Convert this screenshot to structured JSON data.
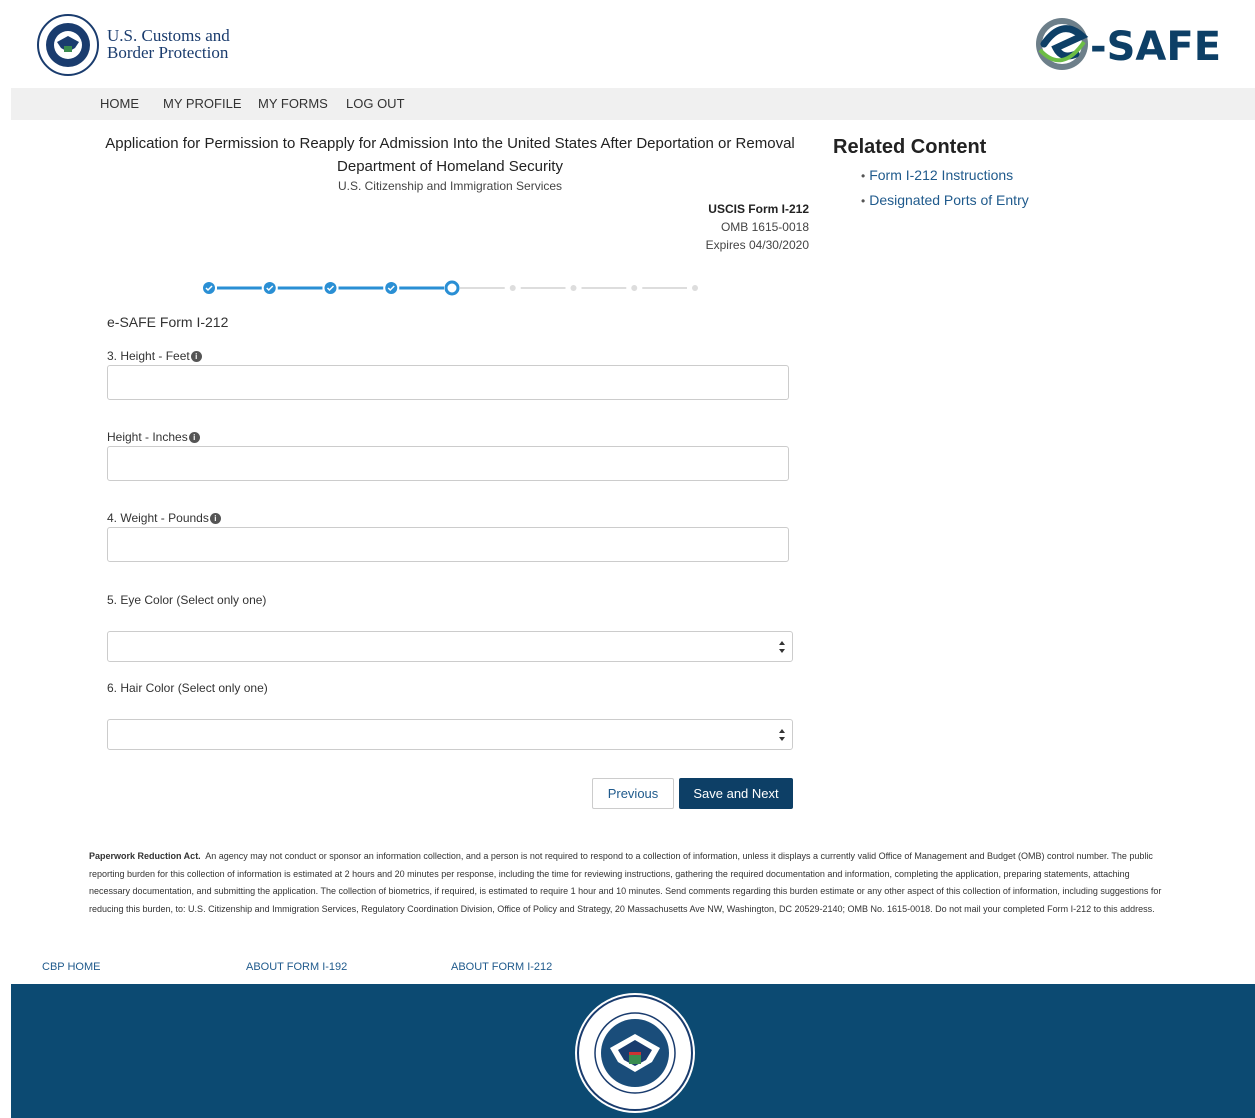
{
  "header": {
    "agency_line1": "U.S. Customs and",
    "agency_line2": "Border Protection",
    "logo_text": "-SAFE"
  },
  "nav": {
    "items": [
      {
        "label": "HOME"
      },
      {
        "label": "MY PROFILE"
      },
      {
        "label": "MY FORMS"
      },
      {
        "label": "LOG OUT"
      }
    ]
  },
  "page": {
    "title": "Application for Permission to Reapply for Admission Into the United States After Deportation or Removal",
    "department": "Department of Homeland Security",
    "agency": "U.S. Citizenship and Immigration Services",
    "form_id": "USCIS Form I-212",
    "omb": "OMB 1615-0018",
    "expires": "Expires 04/30/2020"
  },
  "related": {
    "title": "Related Content",
    "links": [
      {
        "label": "Form I-212 Instructions"
      },
      {
        "label": "Designated Ports of Entry"
      }
    ]
  },
  "progress": {
    "total_steps": 9,
    "current_step": 5,
    "completed_steps": 4
  },
  "form": {
    "heading": "e-SAFE Form I-212",
    "fields": [
      {
        "label": "3. Height - Feet",
        "value": "",
        "type": "text"
      },
      {
        "label": "Height - Inches",
        "value": "",
        "type": "text"
      },
      {
        "label": "4. Weight - Pounds",
        "value": "",
        "type": "text"
      },
      {
        "label": "5. Eye Color (Select only one)",
        "value": "",
        "type": "select"
      },
      {
        "label": "6. Hair Color (Select only one)",
        "value": "",
        "type": "select"
      }
    ],
    "previous_label": "Previous",
    "next_label": "Save and Next"
  },
  "paperwork": {
    "heading": "Paperwork Reduction Act.",
    "body": "An agency may not conduct or sponsor an information collection, and a person is not required to respond to a collection of information, unless it displays a currently valid Office of Management and Budget (OMB) control number.  The public reporting burden for this collection of information is estimated at 2 hours and 20 minutes per response, including the time for reviewing instructions, gathering the required documentation and information, completing the application, preparing statements, attaching necessary documentation, and submitting the application.  The collection of biometrics, if required, is estimated to require 1 hour and 10 minutes.  Send comments regarding this burden estimate or any other aspect of this collection of information, including suggestions for reducing this burden, to:  U.S. Citizenship and Immigration Services, Regulatory Coordination Division, Office of Policy and Strategy, 20 Massachusetts Ave NW, Washington, DC 20529-2140; OMB No. 1615-0018.  Do not mail your completed Form I-212 to this address."
  },
  "footer": {
    "links": [
      {
        "label": "CBP HOME"
      },
      {
        "label": "ABOUT FORM I-192"
      },
      {
        "label": "ABOUT FORM I-212"
      }
    ]
  },
  "colors": {
    "primary": "#0d3f66",
    "link": "#1f5a8c",
    "progress": "#2a8fd4",
    "footer": "#0c4a72"
  }
}
